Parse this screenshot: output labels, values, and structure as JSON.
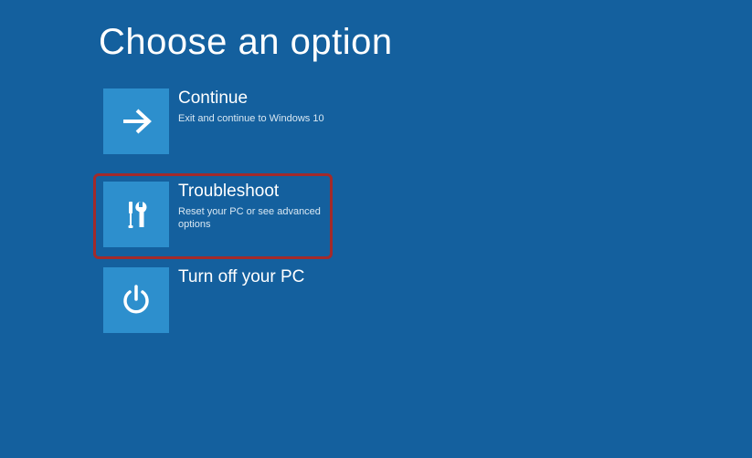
{
  "page": {
    "title": "Choose an option"
  },
  "options": {
    "continue": {
      "title": "Continue",
      "subtitle": "Exit and continue to Windows 10"
    },
    "troubleshoot": {
      "title": "Troubleshoot",
      "subtitle": "Reset your PC or see advanced options",
      "highlighted": true
    },
    "turnoff": {
      "title": "Turn off your PC",
      "subtitle": ""
    }
  },
  "colors": {
    "background": "#14609e",
    "tile": "#2d8fcd",
    "highlight_border": "#a32a2a"
  }
}
